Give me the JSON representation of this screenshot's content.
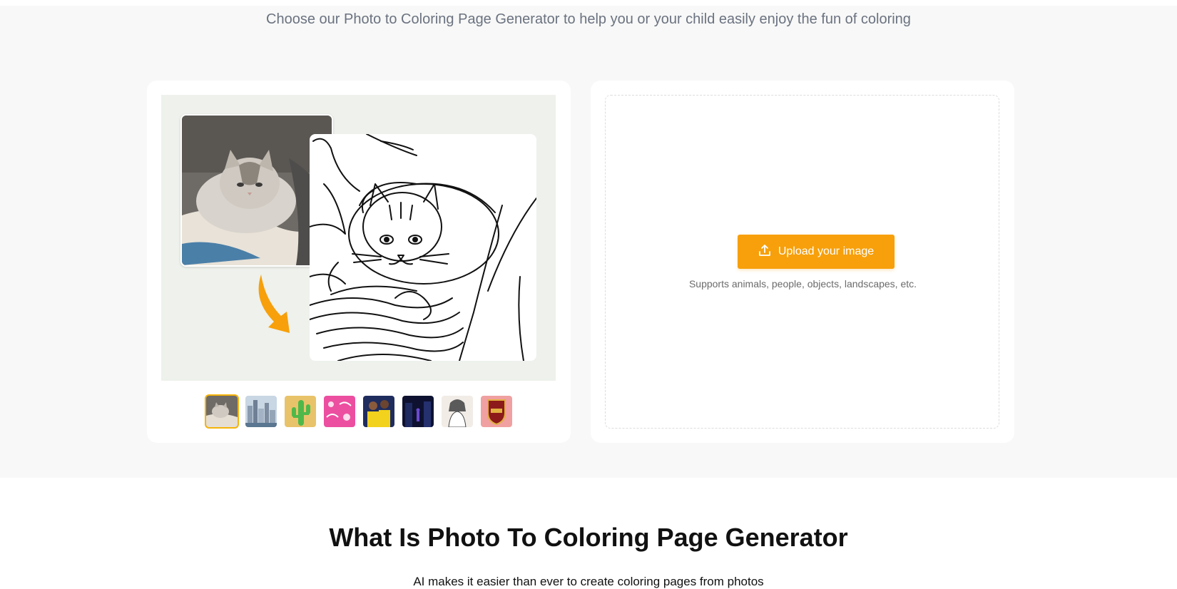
{
  "hero": {
    "subtitle": "Choose our Photo to Coloring Page Generator to help you or your child easily enjoy the fun of coloring"
  },
  "preview": {
    "thumbnails": [
      {
        "name": "cat",
        "active": true,
        "color": "#8a8478"
      },
      {
        "name": "city",
        "active": false,
        "color": "#9fb3c8"
      },
      {
        "name": "cactus",
        "active": false,
        "color": "#e9c36a"
      },
      {
        "name": "barbie",
        "active": false,
        "color": "#ec4fa0"
      },
      {
        "name": "soccer",
        "active": false,
        "color": "#2a3a7a"
      },
      {
        "name": "night",
        "active": false,
        "color": "#14183a"
      },
      {
        "name": "anime-sketch",
        "active": false,
        "color": "#e8e2dc"
      },
      {
        "name": "crest",
        "active": false,
        "color": "#f0a0a0"
      }
    ]
  },
  "upload": {
    "button_label": "Upload your image",
    "hint": "Supports animals, people, objects, landscapes, etc."
  },
  "section": {
    "title": "What Is Photo To Coloring Page Generator",
    "subtitle": "AI makes it easier than ever to create coloring pages from photos"
  },
  "colors": {
    "accent": "#f7a00b",
    "hero_bg": "#f7f8f7",
    "preview_bg": "#eef1ec",
    "thumb_active_border": "#f5b40a"
  }
}
